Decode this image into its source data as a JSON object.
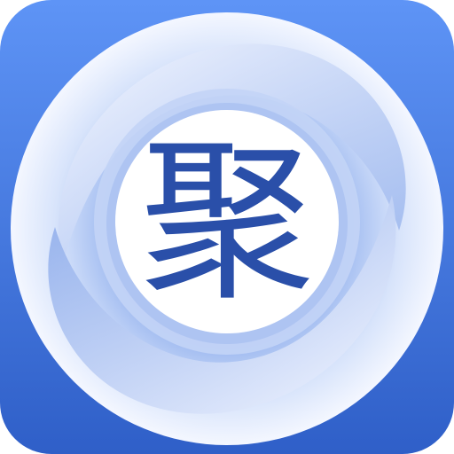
{
  "app_icon": {
    "character": "聚",
    "colors": {
      "background_top": "#5e94f6",
      "background_bottom": "#2f5fc8",
      "ring_light": "#e9f0ff",
      "ring_mid": "#b9cdf6",
      "ring_dark": "#7ea0e6",
      "center_fill": "#ffffff",
      "character": "#2a4fa9"
    }
  }
}
